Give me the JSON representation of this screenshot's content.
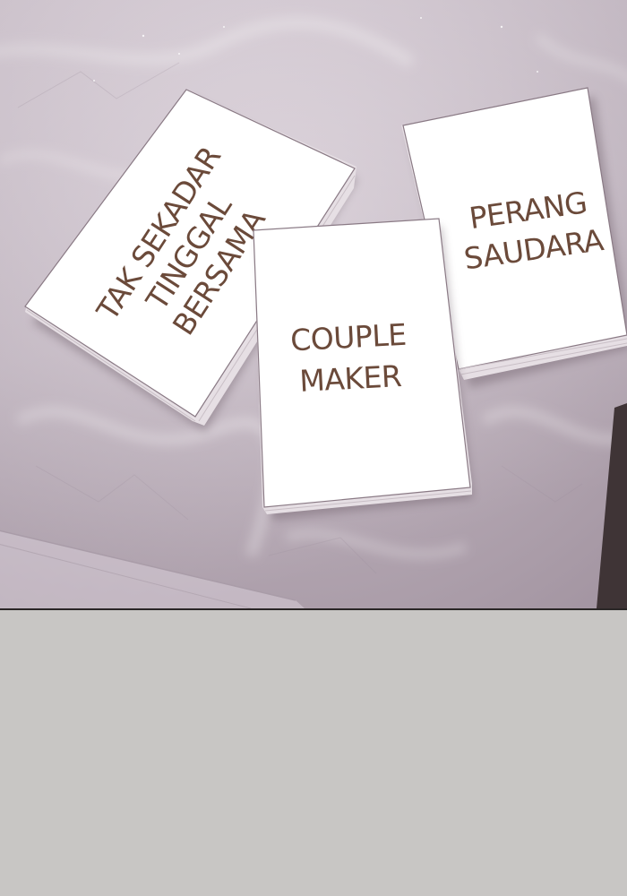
{
  "colors": {
    "surface_top": "#d9d0d8",
    "surface_bottom": "#b9acb7",
    "card": "#ffffff",
    "card_edge": "#e6dfe4",
    "card_text": "#6b4a3a",
    "border": "#2a2626",
    "lower_area": "#c8c6c4"
  },
  "cards": [
    {
      "id": "left-card",
      "lines": [
        "TAK SEKADAR",
        "TINGGAL",
        "BERSAMA"
      ]
    },
    {
      "id": "middle-card",
      "lines": [
        "COUPLE",
        "MAKER"
      ]
    },
    {
      "id": "right-card",
      "lines": [
        "PERANG",
        "SAUDARA"
      ]
    }
  ]
}
